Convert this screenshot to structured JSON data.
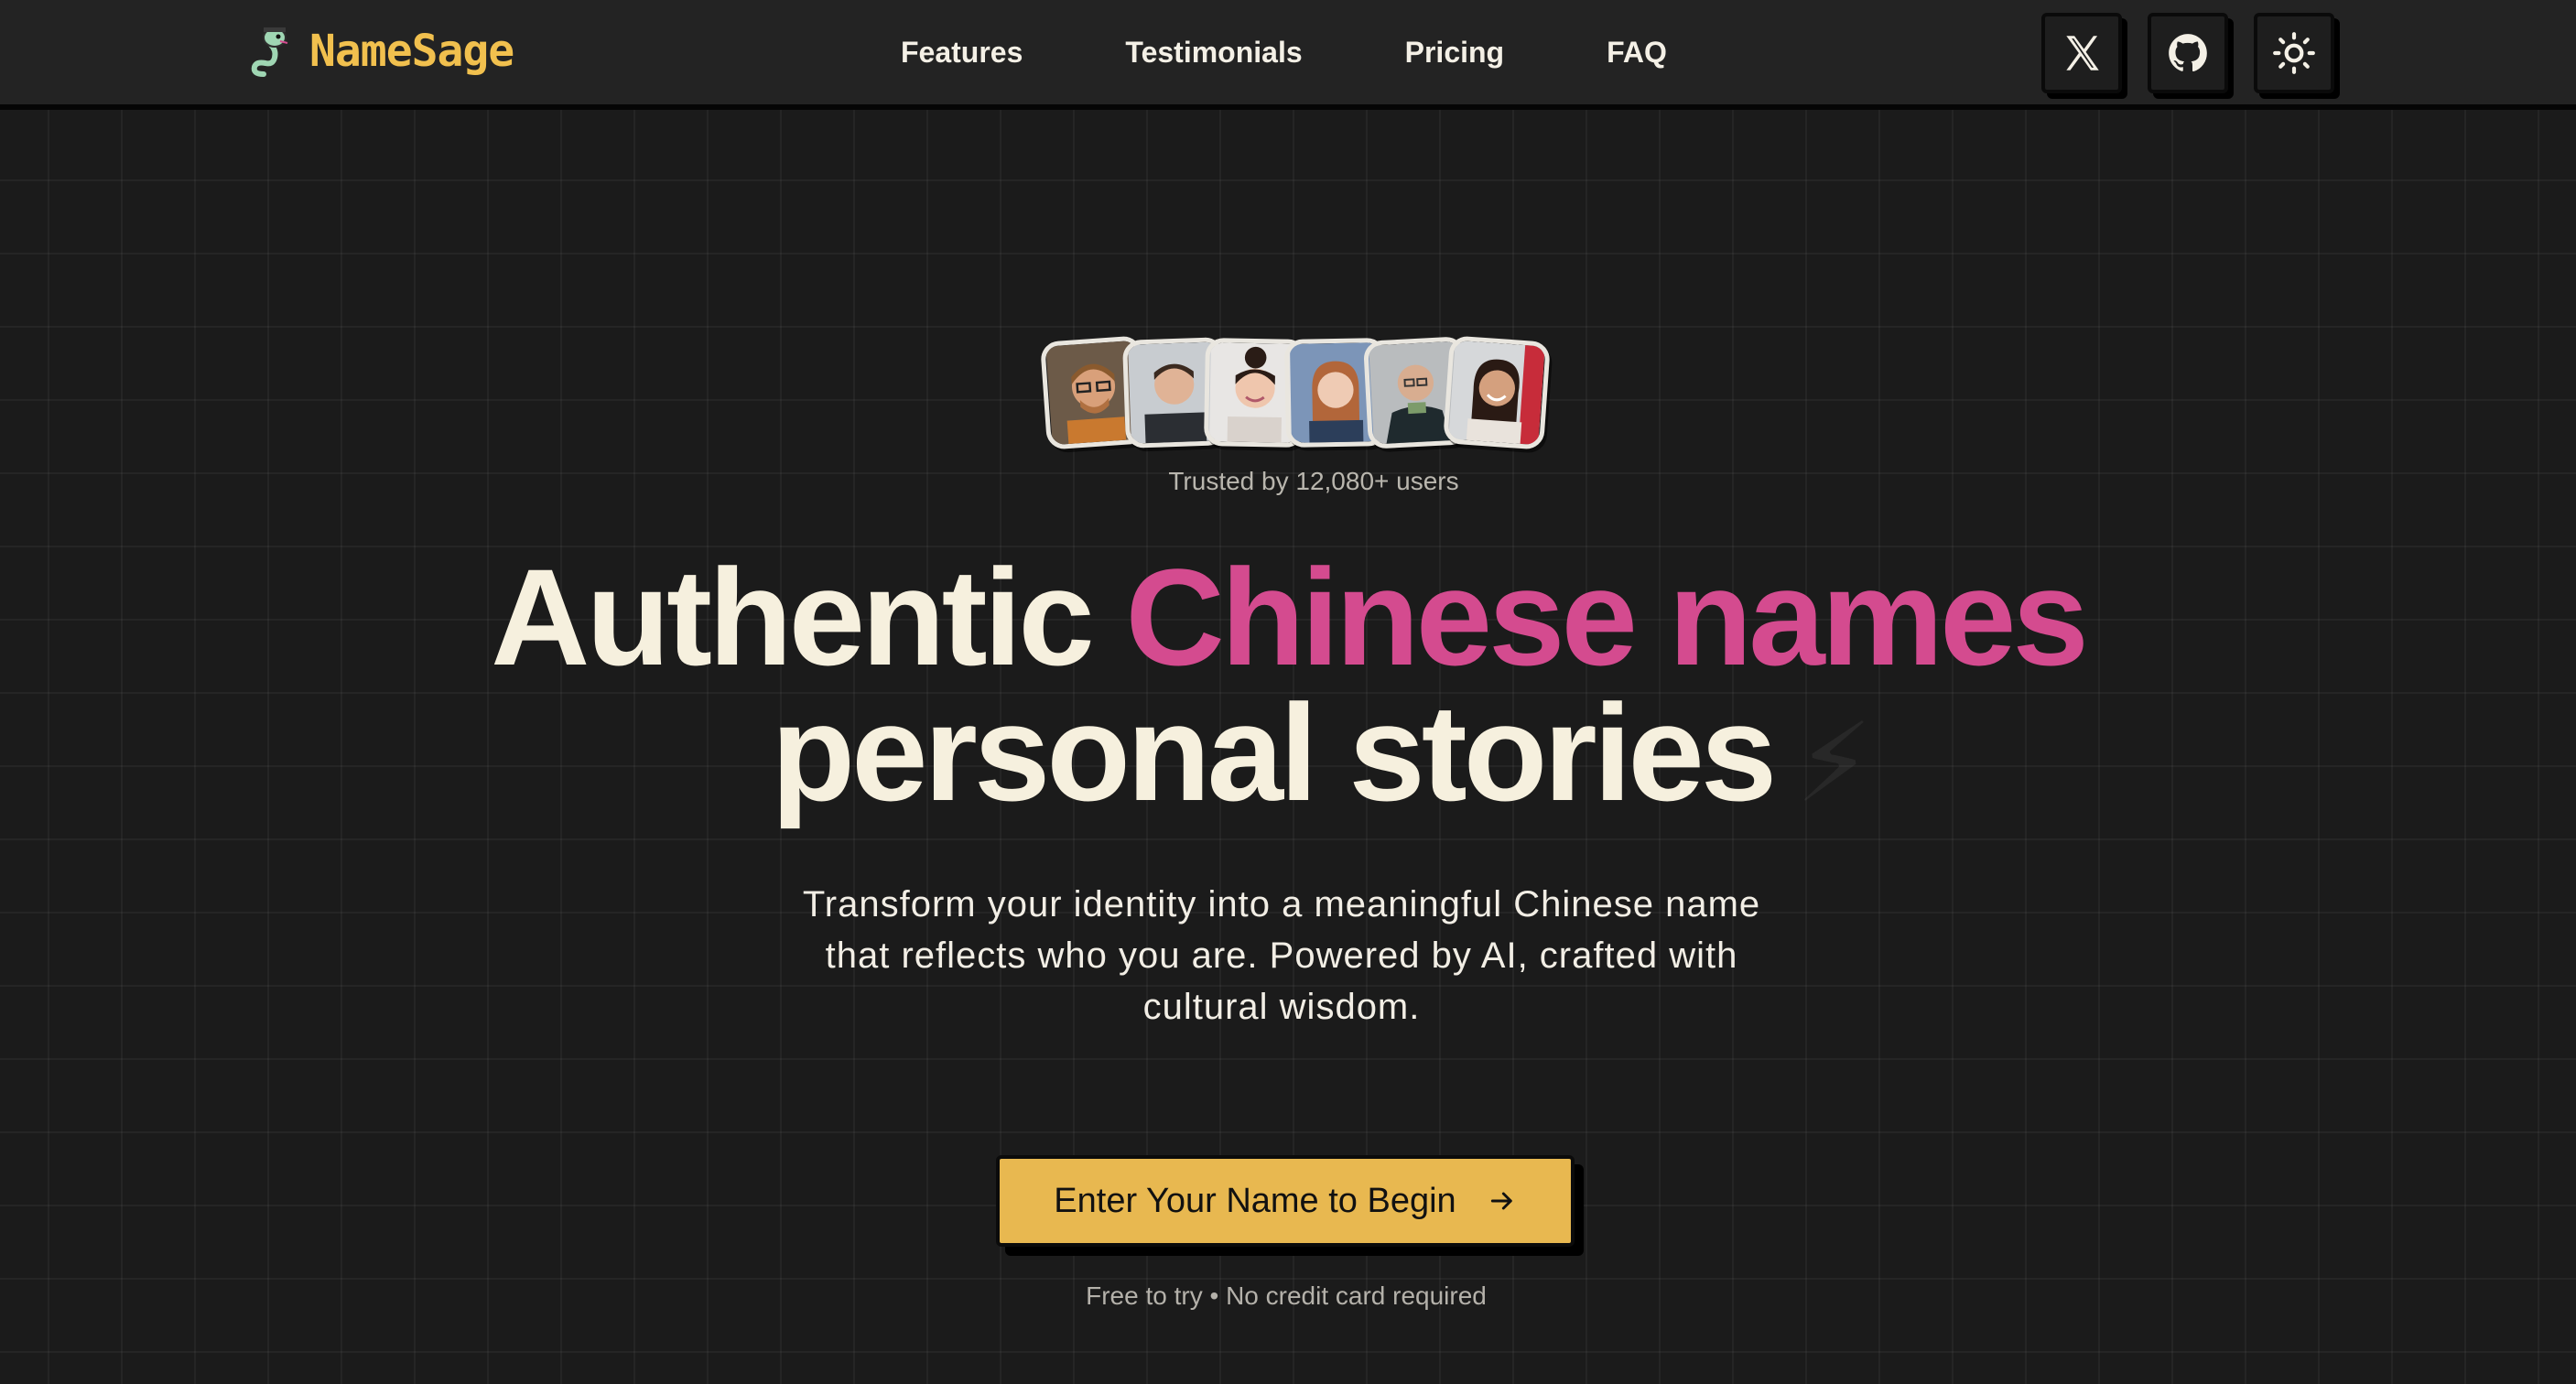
{
  "brand": {
    "name": "NameSage",
    "logo_icon": "snake-scholar-icon",
    "color": "#f1c04e"
  },
  "nav": {
    "links": [
      {
        "label": "Features"
      },
      {
        "label": "Testimonials"
      },
      {
        "label": "Pricing"
      },
      {
        "label": "FAQ"
      }
    ],
    "icons": [
      "x-logo-icon",
      "github-icon",
      "sun-icon"
    ]
  },
  "hero": {
    "avatars": [
      "avatar-man-glasses",
      "avatar-man-dark",
      "avatar-woman-bun",
      "avatar-woman-redhair",
      "avatar-man-bald",
      "avatar-woman-smile"
    ],
    "trusted_text": "Trusted by 12,080+ users",
    "headline_part1": "Authentic ",
    "headline_accent": "Chinese names",
    "headline_line2": "personal stories",
    "subtitle": "Transform your identity into a meaningful Chinese name that reflects who you are. Powered by AI, crafted with cultural wisdom.",
    "cta_label": "Enter Your Name to Begin",
    "footnote": "Free to try • No credit card required"
  },
  "colors": {
    "background": "#1b1b1b",
    "accent_pink": "#d44b8f",
    "cta_yellow": "#e8b850",
    "headline_cream": "#f6f0de"
  }
}
